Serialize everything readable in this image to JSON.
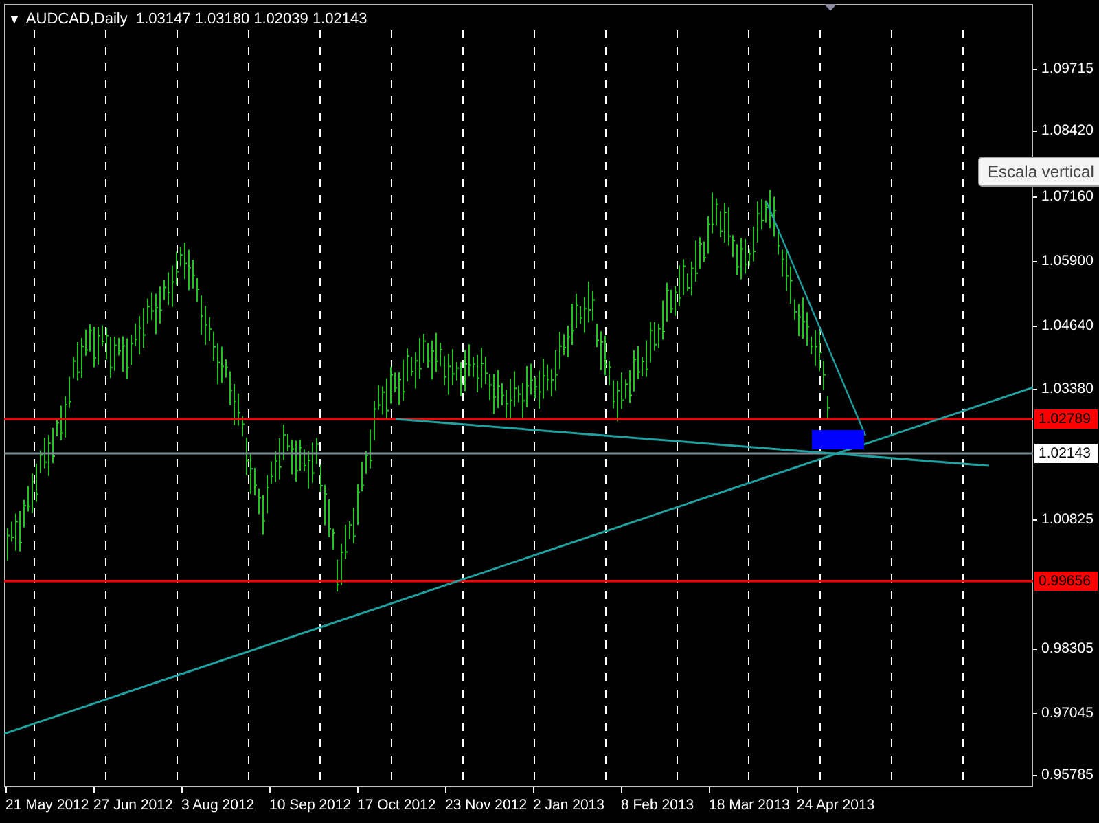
{
  "chart_title": {
    "menu_glyph": "▼",
    "text": "AUDCAD,Daily  1.03147 1.03180 1.02039 1.02143"
  },
  "price_ticks": [
    "1.09715",
    "1.08420",
    "1.07160",
    "1.05900",
    "1.04640",
    "1.03380",
    "1.00825",
    "0.98305",
    "0.97045",
    "0.95785"
  ],
  "levels": [
    {
      "kind": "line",
      "price": "1.02789",
      "color": "#ff0000"
    },
    {
      "kind": "bid",
      "price": "1.02143",
      "color": "#ffffff"
    },
    {
      "kind": "line",
      "price": "0.99656",
      "color": "#ff0000"
    }
  ],
  "date_labels": [
    "21 May 2012",
    "27 Jun 2012",
    "3 Aug 2012",
    "10 Sep 2012",
    "17 Oct 2012",
    "23 Nov 2012",
    "2 Jan 2013",
    "8 Feb 2013",
    "18 Mar 2013",
    "24 Apr 2013"
  ],
  "tooltip": {
    "text": "Escala vertical"
  }
}
